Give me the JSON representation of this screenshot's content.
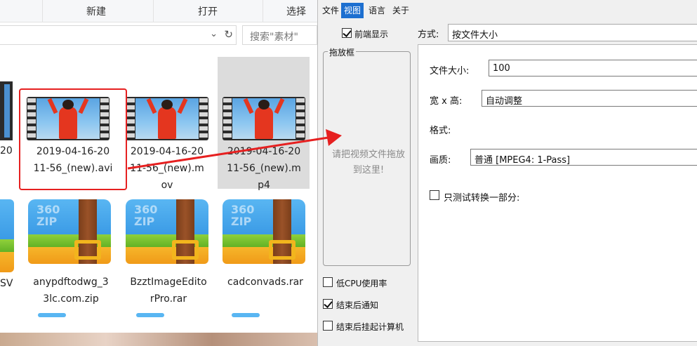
{
  "explorer": {
    "ribbon": {
      "new_label": "新建",
      "open_label": "打开",
      "select_label": "选择"
    },
    "search": {
      "placeholder": "搜索\"素材\""
    },
    "files": [
      {
        "name": "2019-04-16-20\n11-56_(new).avi",
        "type": "video",
        "selected_highlight": "red-box"
      },
      {
        "name": "2019-04-16-20\n11-56_(new).m\nov",
        "type": "video"
      },
      {
        "name": "2019-04-16-20\n11-56_(new).m\np4",
        "type": "video",
        "selected": true
      },
      {
        "name": "anypdftodwg_3\n3lc.com.zip",
        "type": "archive"
      },
      {
        "name": "BzztImageEdito\nrPro.rar",
        "type": "archive"
      },
      {
        "name": "cadconvads.rar",
        "type": "archive"
      }
    ],
    "left_cut_text": {
      "row1": "20",
      "row2": "SV"
    },
    "archive_brand": "360\nZIP",
    "colors": {
      "selection_box": "#e62020",
      "arrow": "#e62020"
    }
  },
  "app": {
    "menu": [
      {
        "label": "文件",
        "active": false
      },
      {
        "label": "视图",
        "active": true
      },
      {
        "label": "语言",
        "active": false
      },
      {
        "label": "关于",
        "active": false
      }
    ],
    "front_display": {
      "label": "前端显示",
      "checked": true
    },
    "dropbox": {
      "title": "拖放框",
      "hint": "请把视频文件拖放到这里!"
    },
    "mode": {
      "label": "方式:",
      "value": "按文件大小"
    },
    "settings": {
      "file_size": {
        "label": "文件大小:",
        "value": "100"
      },
      "dimensions": {
        "label": "宽 x 高:",
        "value": "自动调整"
      },
      "format": {
        "label": "格式:"
      },
      "quality": {
        "label": "画质:",
        "value": "普通  [MPEG4: 1-Pass]"
      },
      "partial_test": {
        "label": "只测试转换一部分:",
        "checked": false
      }
    },
    "options": [
      {
        "label": "低CPU使用率",
        "checked": false
      },
      {
        "label": "结束后通知",
        "checked": true
      },
      {
        "label": "结束后挂起计算机",
        "checked": false
      }
    ],
    "colors": {
      "menu_active": "#1d6fd0",
      "background": "#f0f0f0"
    }
  }
}
